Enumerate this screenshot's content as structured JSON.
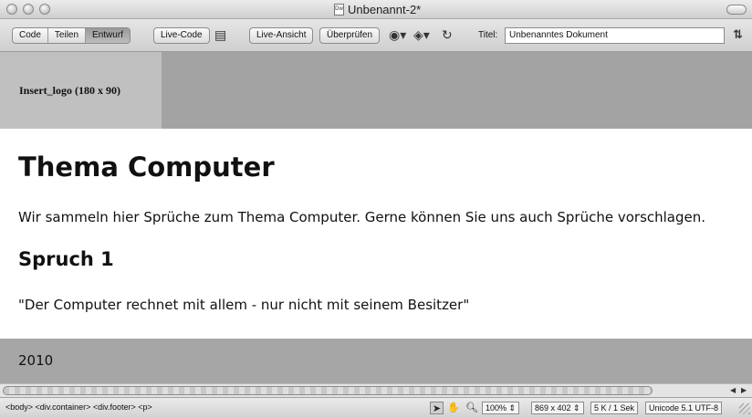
{
  "window": {
    "title": "Unbenannt-2*",
    "doc_icon": "Dw"
  },
  "toolbar": {
    "view_modes": [
      "Code",
      "Teilen",
      "Entwurf"
    ],
    "active_mode": "Entwurf",
    "live_code": "Live-Code",
    "live_view": "Live-Ansicht",
    "check": "Überprüfen",
    "title_label": "Titel:",
    "title_value": "Unbenanntes Dokument"
  },
  "page": {
    "logo_placeholder": "Insert_logo (180 x 90)",
    "heading": "Thema Computer",
    "intro": "Wir sammeln hier Sprüche zum Thema Computer. Gerne können Sie uns auch Sprüche vorschlagen.",
    "subheading": "Spruch 1",
    "quote": "\"Der Computer rechnet mit allem - nur nicht mit seinem Besitzer\"",
    "footer": "2010"
  },
  "statusbar": {
    "tag_path": "<body> <div.container> <div.footer> <p>",
    "zoom": "100%",
    "window_size": "869 x 402",
    "file_info": "5 K / 1 Sek",
    "encoding": "Unicode 5.1 UTF-8"
  }
}
